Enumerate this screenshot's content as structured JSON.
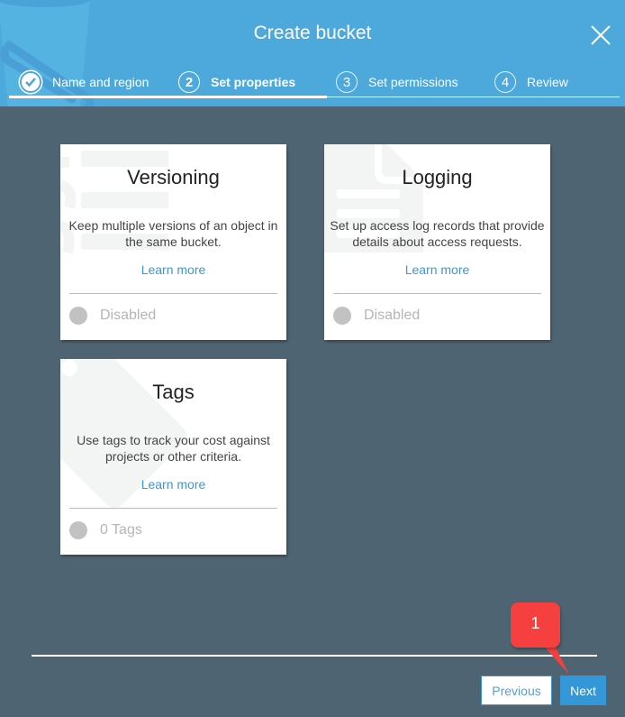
{
  "dialog": {
    "title": "Create bucket",
    "close_icon": "close-icon"
  },
  "steps": [
    {
      "number": "1",
      "label": "Name and region",
      "state": "completed",
      "icon": "check-circle-icon"
    },
    {
      "number": "2",
      "label": "Set properties",
      "state": "active"
    },
    {
      "number": "3",
      "label": "Set permissions",
      "state": "inactive"
    },
    {
      "number": "4",
      "label": "Review",
      "state": "inactive"
    }
  ],
  "cards": [
    {
      "title": "Versioning",
      "description": "Keep multiple versions of an object in the same bucket.",
      "link": "Learn more",
      "status": "Disabled",
      "watermark_icon": "versions-icon"
    },
    {
      "title": "Logging",
      "description": "Set up access log records that provide details about access requests.",
      "link": "Learn more",
      "status": "Disabled",
      "watermark_icon": "document-icon"
    },
    {
      "title": "Tags",
      "description": "Use tags to track your cost against projects or other criteria.",
      "link": "Learn more",
      "status": "0 Tags",
      "watermark_icon": "tag-icon"
    }
  ],
  "footer": {
    "previous_label": "Previous",
    "next_label": "Next"
  },
  "annotation": {
    "label": "1",
    "color": "#f63f3f"
  },
  "colors": {
    "header": "#4da8dc",
    "background": "#4f6472",
    "link": "#3b98d4",
    "primary_button": "#3497d8"
  }
}
